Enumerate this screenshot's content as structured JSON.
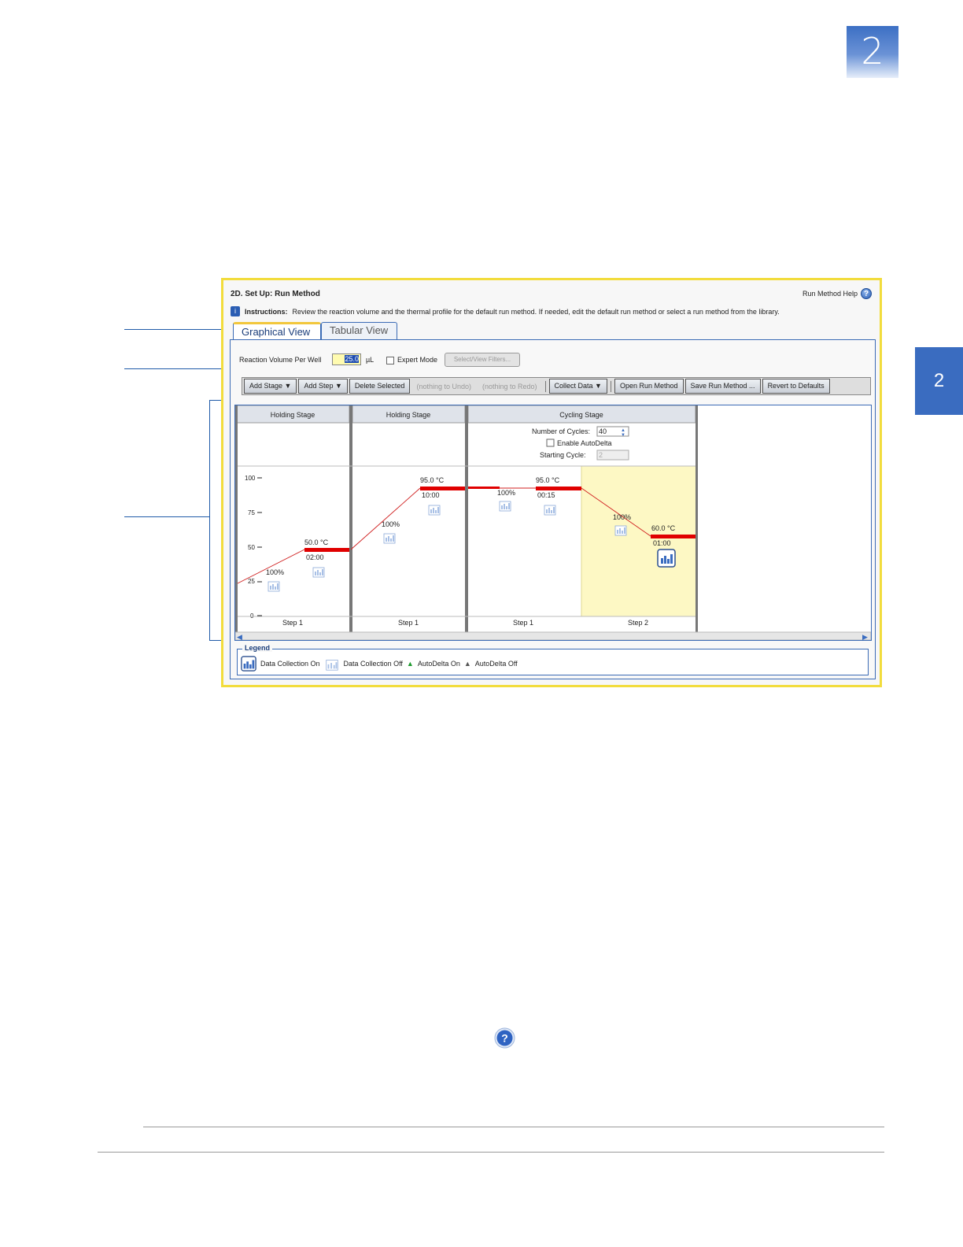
{
  "chapter_number": "2",
  "side_tab_number": "2",
  "panel": {
    "title": "2D. Set Up: Run Method",
    "help_label": "Run Method Help",
    "instructions_label": "Instructions:",
    "instructions_text": "Review the reaction volume and the thermal profile for the default run method. If needed, edit the default run method or select a run method from the library."
  },
  "tabs": [
    {
      "label": "Graphical View",
      "active": true
    },
    {
      "label": "Tabular View",
      "active": false
    }
  ],
  "reaction_volume": {
    "label": "Reaction Volume Per Well",
    "value": "25.0",
    "unit": "µL"
  },
  "expert_mode_label": "Expert Mode",
  "filters_button": "Select/View Filters...",
  "toolbar": {
    "add_stage": "Add Stage ▼",
    "add_step": "Add Step ▼",
    "delete_selected": "Delete Selected",
    "undo": "(nothing to Undo)",
    "redo": "(nothing to Redo)",
    "collect_data": "Collect Data ▼",
    "open_run_method": "Open Run Method",
    "save_run_method": "Save Run Method ...",
    "revert_to_defaults": "Revert to Defaults"
  },
  "y_ticks": [
    "100",
    "75",
    "50",
    "25",
    "0"
  ],
  "stages": [
    {
      "name": "Holding Stage",
      "steps": [
        {
          "label": "Step 1",
          "temp": "50.0 °C",
          "time": "02:00",
          "ramp": "100%"
        }
      ]
    },
    {
      "name": "Holding Stage",
      "steps": [
        {
          "label": "Step 1",
          "temp": "95.0 °C",
          "time": "10:00",
          "ramp": "100%"
        }
      ]
    },
    {
      "name": "Cycling Stage",
      "cycles_label": "Number of Cycles:",
      "cycles_value": "40",
      "autodelta_label": "Enable AutoDelta",
      "starting_cycle_label": "Starting Cycle:",
      "starting_cycle_value": "2",
      "steps": [
        {
          "label": "Step 1",
          "temp": "95.0 °C",
          "time": "00:15",
          "ramp": "100%"
        },
        {
          "label": "Step 2",
          "temp": "60.0 °C",
          "time": "01:00",
          "ramp": "100%"
        }
      ]
    }
  ],
  "legend": {
    "title": "Legend",
    "data_on": "Data Collection On",
    "data_off": "Data Collection Off",
    "autodelta_on": "AutoDelta On",
    "autodelta_off": "AutoDelta Off"
  },
  "colors": {
    "accent_blue": "#3a6cc0",
    "frame_yellow": "#f2dc3c",
    "hold_line": "#e00000",
    "ramp_line": "#d02020",
    "selected_step_bg": "#fdf8c4"
  }
}
